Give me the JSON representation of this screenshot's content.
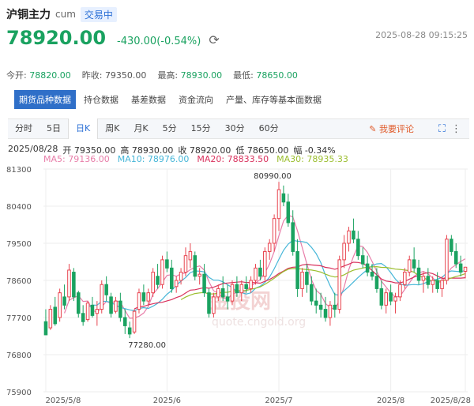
{
  "header": {
    "name": "沪铜主力",
    "code": "cum",
    "status": "交易中",
    "last_price": "78920.00",
    "change": "-430.00(-0.54%)",
    "datetime": "2025-08-28 09:15:25",
    "refresh_icon": "refresh-icon"
  },
  "quotes": {
    "open_label": "今开:",
    "open": "78820.00",
    "prev_label": "昨收:",
    "prev": "79350.00",
    "high_label": "最高:",
    "high": "78930.00",
    "low_label": "最低:",
    "low": "78650.00"
  },
  "subtabs": [
    "期货品种数据",
    "持仓数据",
    "基差数据",
    "资金流向",
    "产量、库存等基本面数据"
  ],
  "chart_tabs": [
    "分时",
    "5日",
    "日K",
    "周K",
    "月K",
    "5分",
    "15分",
    "30分",
    "60分"
  ],
  "comment_label": "我要评论",
  "info": {
    "date": "2025/08/28",
    "open": "开 79350.00",
    "high": "高 78930.00",
    "close": "收 78920.00",
    "low": "低 78650.00",
    "amp": "幅 -0.34%"
  },
  "ma": {
    "ma5": "MA5: 79136.00",
    "ma10": "MA10: 78976.00",
    "ma20": "MA20: 78833.50",
    "ma30": "MA30: 78935.33"
  },
  "watermark": {
    "cn": "金投网",
    "url": "quote.cngold.org"
  },
  "colors": {
    "up": "#e8444f",
    "down": "#1aa260",
    "accent": "#2f6fc8",
    "ma5": "#e87ea9",
    "ma10": "#46b6d8",
    "ma20": "#d9315d",
    "ma30": "#9bbe2e"
  },
  "chart_data": {
    "type": "candlestick",
    "ylim": [
      75900,
      81300
    ],
    "yticks": [
      "81300",
      "80400",
      "79500",
      "78600",
      "77700",
      "76800",
      "75900"
    ],
    "xticks": [
      "2025/5/8",
      "2025/6",
      "2025/7",
      "2025/8",
      "2025/8/28"
    ],
    "max_label": "80990.00",
    "min_label": "77280.00",
    "candles": [
      [
        77600,
        77900,
        77300,
        77280
      ],
      [
        77450,
        78000,
        77400,
        77900
      ],
      [
        77950,
        78200,
        77500,
        77550
      ],
      [
        77700,
        78400,
        77600,
        78300
      ],
      [
        78200,
        78500,
        77900,
        78000
      ],
      [
        78200,
        79000,
        78100,
        78850
      ],
      [
        78800,
        78900,
        78100,
        78200
      ],
      [
        78300,
        78350,
        77700,
        77800
      ],
      [
        77800,
        78000,
        77500,
        77600
      ],
      [
        77650,
        78100,
        77600,
        78050
      ],
      [
        78000,
        78200,
        77700,
        77750
      ],
      [
        77800,
        78100,
        77500,
        77900
      ],
      [
        77900,
        78600,
        77800,
        78500
      ],
      [
        78500,
        78700,
        78100,
        78250
      ],
      [
        78200,
        78300,
        77700,
        77800
      ],
      [
        77850,
        78200,
        77800,
        78100
      ],
      [
        78100,
        78300,
        77600,
        77700
      ],
      [
        77700,
        77900,
        77300,
        77500
      ],
      [
        77450,
        77600,
        77200,
        77300
      ],
      [
        77350,
        77900,
        77300,
        77850
      ],
      [
        77900,
        78400,
        77800,
        78300
      ],
      [
        78300,
        78500,
        78000,
        78100
      ],
      [
        78100,
        78400,
        78000,
        78300
      ],
      [
        78300,
        78900,
        78200,
        78800
      ],
      [
        78700,
        79000,
        78400,
        78500
      ],
      [
        78500,
        79200,
        78400,
        79100
      ],
      [
        79100,
        79300,
        78800,
        78900
      ],
      [
        78900,
        79100,
        78300,
        78400
      ],
      [
        78450,
        78700,
        78300,
        78600
      ],
      [
        78600,
        78900,
        78500,
        78800
      ],
      [
        78800,
        79400,
        78700,
        79200
      ],
      [
        79100,
        79500,
        78900,
        79300
      ],
      [
        79200,
        79300,
        78600,
        78700
      ],
      [
        78700,
        78900,
        78500,
        78750
      ],
      [
        78750,
        79000,
        78200,
        78300
      ],
      [
        78300,
        78400,
        77700,
        77800
      ],
      [
        77800,
        78300,
        77700,
        78200
      ],
      [
        78200,
        78500,
        78100,
        78400
      ],
      [
        78400,
        78700,
        78100,
        78200
      ],
      [
        78200,
        78500,
        77900,
        78100
      ],
      [
        78100,
        78600,
        78000,
        78500
      ],
      [
        78500,
        78700,
        78200,
        78300
      ],
      [
        78300,
        78600,
        78100,
        78500
      ],
      [
        78500,
        78700,
        78300,
        78400
      ],
      [
        78400,
        78700,
        78300,
        78600
      ],
      [
        78600,
        79000,
        78500,
        78900
      ],
      [
        78900,
        79100,
        78600,
        78700
      ],
      [
        78700,
        79400,
        78600,
        79300
      ],
      [
        79300,
        79600,
        79100,
        79500
      ],
      [
        79500,
        80200,
        79300,
        80100
      ],
      [
        80100,
        80990,
        79800,
        80800
      ],
      [
        80700,
        80900,
        80400,
        80500
      ],
      [
        80500,
        80700,
        79900,
        80000
      ],
      [
        80000,
        80300,
        79200,
        79300
      ],
      [
        79300,
        79600,
        78200,
        78400
      ],
      [
        78400,
        78900,
        78200,
        78800
      ],
      [
        78800,
        79000,
        78300,
        78500
      ],
      [
        78500,
        78700,
        78000,
        78100
      ],
      [
        78100,
        78400,
        77800,
        78000
      ],
      [
        78000,
        78300,
        77700,
        77900
      ],
      [
        77900,
        78200,
        77600,
        77700
      ],
      [
        77700,
        78100,
        77500,
        78000
      ],
      [
        78000,
        78300,
        77700,
        77900
      ],
      [
        77900,
        79200,
        77800,
        79100
      ],
      [
        79100,
        79700,
        78900,
        79500
      ],
      [
        79500,
        79900,
        79300,
        79800
      ],
      [
        79800,
        80100,
        79500,
        79600
      ],
      [
        79600,
        79800,
        79100,
        79200
      ],
      [
        79200,
        79400,
        78900,
        79000
      ],
      [
        79000,
        79200,
        78700,
        78800
      ],
      [
        78800,
        79000,
        78600,
        78700
      ],
      [
        78700,
        78900,
        78300,
        78400
      ],
      [
        78400,
        78600,
        77900,
        78000
      ],
      [
        78000,
        78400,
        77800,
        78300
      ],
      [
        78300,
        78500,
        78000,
        78100
      ],
      [
        78100,
        78300,
        77800,
        78200
      ],
      [
        78200,
        78600,
        78100,
        78500
      ],
      [
        78500,
        78900,
        78400,
        78800
      ],
      [
        78800,
        79200,
        78700,
        79100
      ],
      [
        79100,
        79400,
        78800,
        78900
      ],
      [
        78900,
        79100,
        78500,
        78600
      ],
      [
        78600,
        78800,
        78300,
        78700
      ],
      [
        78700,
        78900,
        78400,
        78500
      ],
      [
        78500,
        78700,
        78300,
        78600
      ],
      [
        78600,
        78800,
        78300,
        78400
      ],
      [
        78400,
        78700,
        78200,
        78600
      ],
      [
        78600,
        79700,
        78500,
        79600
      ],
      [
        79600,
        79700,
        79200,
        79300
      ],
      [
        79300,
        79500,
        78900,
        79000
      ],
      [
        79000,
        79200,
        78700,
        78800
      ],
      [
        78820,
        78930,
        78650,
        78920
      ]
    ]
  }
}
